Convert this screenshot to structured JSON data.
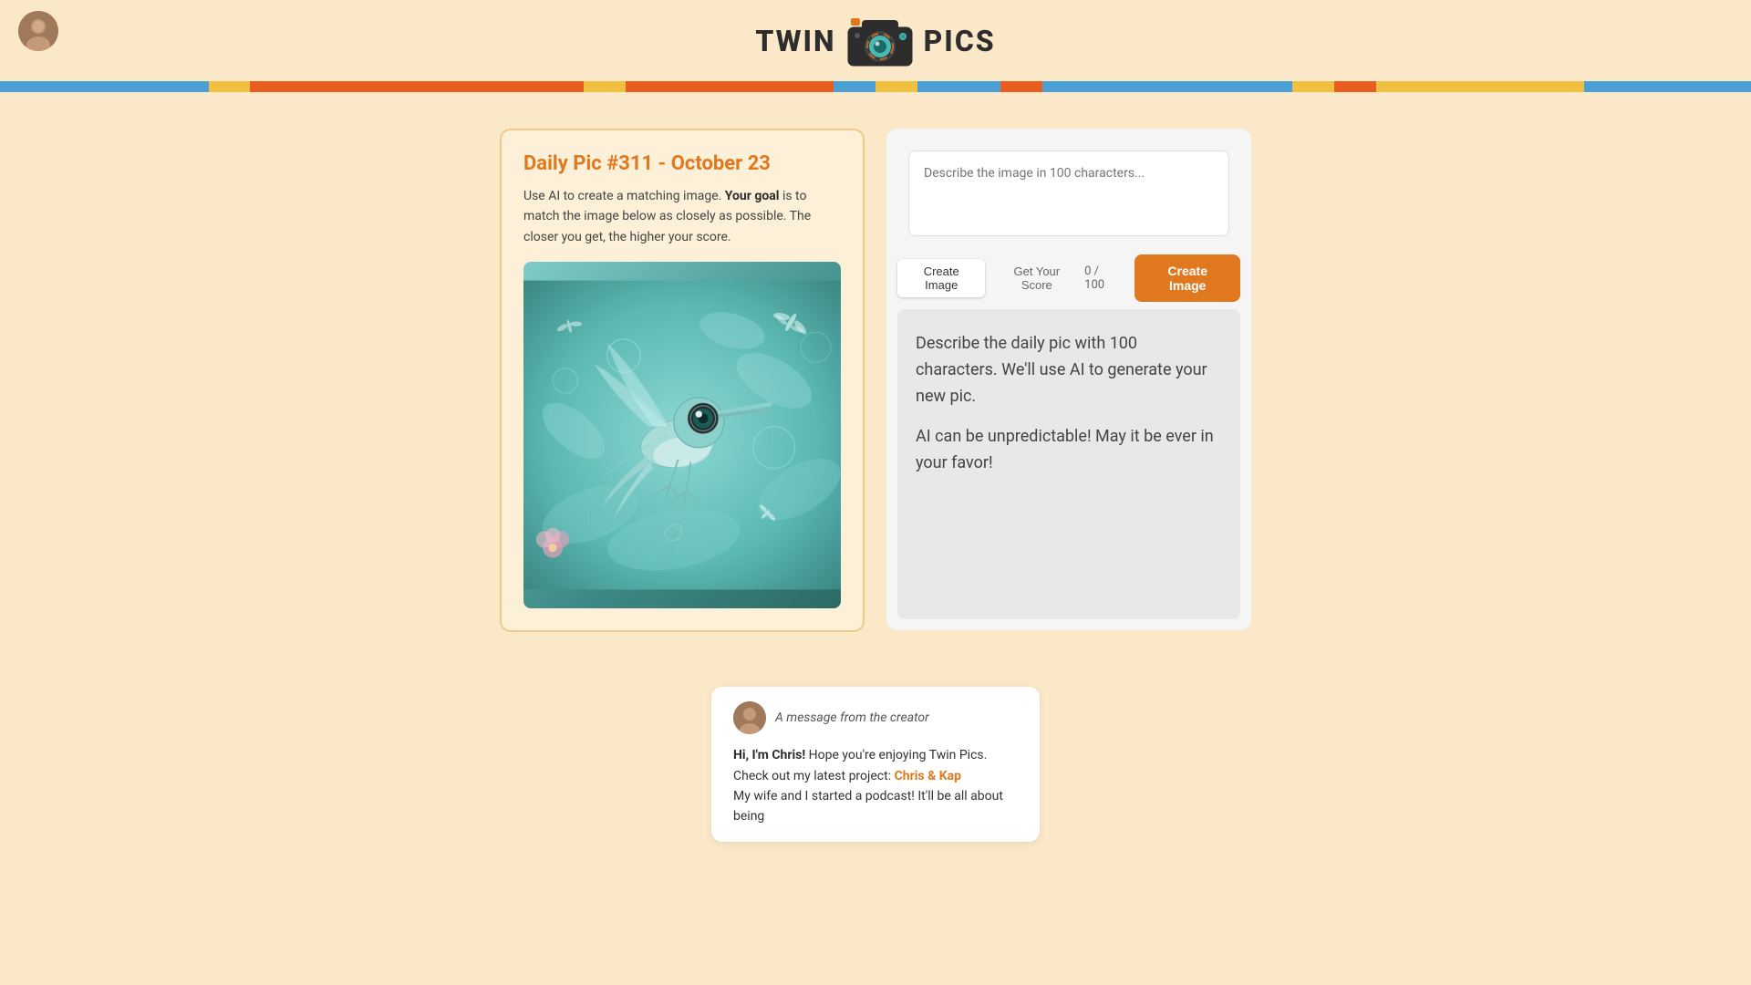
{
  "app": {
    "title": "Twin Pics",
    "logo_left": "TWIN",
    "logo_right": "PICS"
  },
  "color_stripe": [
    {
      "color": "#4a9fd4",
      "flex": 5
    },
    {
      "color": "#f0c040",
      "flex": 1
    },
    {
      "color": "#e85c20",
      "flex": 8
    },
    {
      "color": "#f0c040",
      "flex": 1
    },
    {
      "color": "#e85c20",
      "flex": 5
    },
    {
      "color": "#4a9fd4",
      "flex": 1
    },
    {
      "color": "#f0c040",
      "flex": 1
    },
    {
      "color": "#4a9fd4",
      "flex": 2
    },
    {
      "color": "#e85c20",
      "flex": 1
    },
    {
      "color": "#4a9fd4",
      "flex": 6
    },
    {
      "color": "#f0c040",
      "flex": 1
    },
    {
      "color": "#e85c20",
      "flex": 1
    },
    {
      "color": "#f0c040",
      "flex": 5
    },
    {
      "color": "#4a9fd4",
      "flex": 4
    }
  ],
  "daily_pic": {
    "title": "Daily Pic #311 - ",
    "date": "October 23",
    "description_plain": "Use AI to create a matching image. ",
    "description_goal_label": "Your goal",
    "description_rest": " is to match the image below as closely as possible. The closer you get, the higher your score."
  },
  "interaction": {
    "textarea_placeholder": "Describe the image in 100 characters...",
    "tab_create": "Create Image",
    "tab_score": "Get Your Score",
    "char_count": "0 / 100",
    "create_button": "Create Image",
    "info_line1": "Describe the daily pic with 100 characters. We'll use AI to generate your new pic.",
    "info_line2": "AI can be unpredictable! May it be ever in your favor!"
  },
  "creator_message": {
    "header": "A message from the creator",
    "intro_bold": "Hi, I'm Chris!",
    "intro_rest": " Hope you're enjoying Twin Pics. Check out my latest project: ",
    "project_link": "Chris & Kap",
    "body_rest": "My wife and I started a podcast! It'll be all about being"
  }
}
